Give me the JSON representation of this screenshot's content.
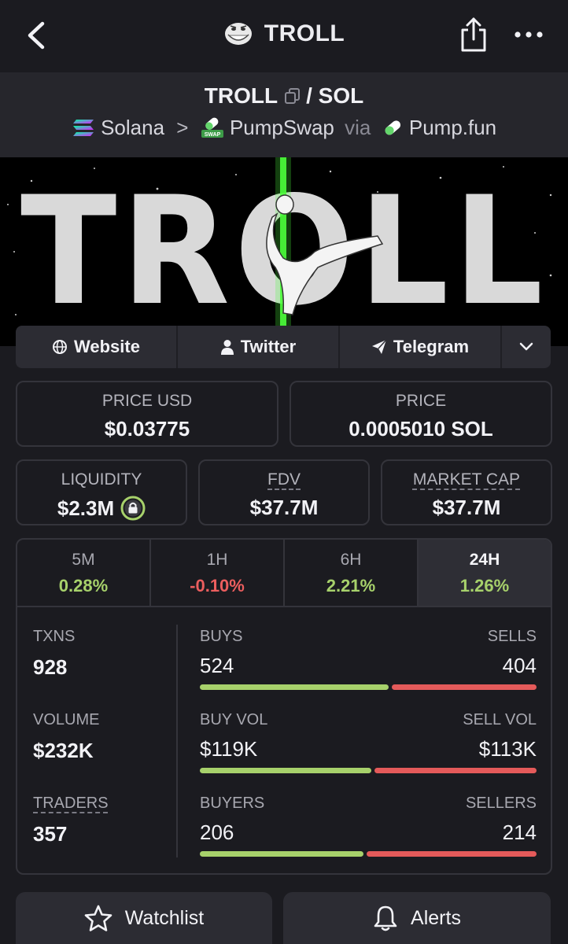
{
  "header": {
    "title": "TROLL",
    "icons": {
      "back": "chevron-left-icon",
      "share": "share-icon",
      "more": "more-dots-icon",
      "logo": "troll-face-icon"
    }
  },
  "pair": {
    "base": "TROLL",
    "separator": "/",
    "quote": "SOL",
    "chain": "Solana",
    "chevron": ">",
    "dex": "PumpSwap",
    "dex_badge": "SWAP",
    "via": "via",
    "launchpad": "Pump.fun"
  },
  "banner": {
    "logo_text": "TROLL"
  },
  "links": [
    {
      "label": "Website",
      "icon": "globe-icon"
    },
    {
      "label": "Twitter",
      "icon": "user-icon"
    },
    {
      "label": "Telegram",
      "icon": "paper-plane-icon"
    }
  ],
  "prices": {
    "usd_label": "PRICE USD",
    "usd_value": "$0.03775",
    "native_label": "PRICE",
    "native_value": "0.0005010 SOL"
  },
  "metrics": {
    "liquidity_label": "LIQUIDITY",
    "liquidity_value": "$2.3M",
    "fdv_label": "FDV",
    "fdv_value": "$37.7M",
    "mcap_label": "MARKET CAP",
    "mcap_value": "$37.7M"
  },
  "timeframes": [
    {
      "label": "5M",
      "change": "0.28%",
      "positive": true
    },
    {
      "label": "1H",
      "change": "-0.10%",
      "positive": false
    },
    {
      "label": "6H",
      "change": "2.21%",
      "positive": true
    },
    {
      "label": "24H",
      "change": "1.26%",
      "positive": true,
      "active": true
    }
  ],
  "stats": {
    "txns": {
      "label": "TXNS",
      "value": "928",
      "left_label": "BUYS",
      "left_value": "524",
      "right_label": "SELLS",
      "right_value": "404",
      "buy_fraction": 0.565
    },
    "volume": {
      "label": "VOLUME",
      "value": "$232K",
      "left_label": "BUY VOL",
      "left_value": "$119K",
      "right_label": "SELL VOL",
      "right_value": "$113K",
      "buy_fraction": 0.513
    },
    "traders": {
      "label": "TRADERS",
      "value": "357",
      "left_label": "BUYERS",
      "left_value": "206",
      "right_label": "SELLERS",
      "right_value": "214",
      "buy_fraction": 0.49
    }
  },
  "actions": {
    "watchlist": "Watchlist",
    "alerts": "Alerts"
  },
  "colors": {
    "background": "#1b1b20",
    "positive": "#a7d16b",
    "negative": "#ec5e5e",
    "accent_green": "#4dff3a"
  }
}
